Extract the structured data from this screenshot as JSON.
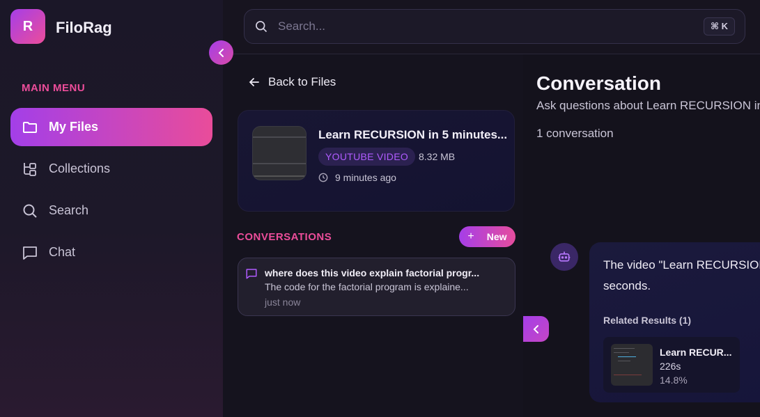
{
  "app": {
    "logo_letter": "R",
    "name": "FiloRag"
  },
  "sidebar": {
    "menu_title": "MAIN MENU",
    "items": [
      {
        "label": "My Files",
        "icon": "folder-icon",
        "active": true
      },
      {
        "label": "Collections",
        "icon": "collections-icon",
        "active": false
      },
      {
        "label": "Search",
        "icon": "search-icon",
        "active": false
      },
      {
        "label": "Chat",
        "icon": "chat-icon",
        "active": false
      }
    ]
  },
  "search": {
    "placeholder": "Search...",
    "shortcut": "⌘ K"
  },
  "file": {
    "back_label": "Back to Files",
    "title": "Learn RECURSION in 5 minutes...",
    "type_badge": "YOUTUBE VIDEO",
    "size": "8.32 MB",
    "uploaded": "9 minutes ago"
  },
  "conversations": {
    "title": "CONVERSATIONS",
    "new_label": "New",
    "items": [
      {
        "question": "where does this video explain factorial progr...",
        "answer": "The code for the factorial program is explaine...",
        "time": "just now"
      }
    ]
  },
  "conversation_panel": {
    "title": "Conversation",
    "subtitle": "Ask questions about Learn RECURSION in",
    "count": "1 conversation",
    "bot_message_line1": "The video \"Learn RECURSION",
    "bot_message_line2": "seconds.",
    "related_title": "Related Results (1)",
    "related": [
      {
        "title": "Learn RECUR...",
        "time": "226s",
        "score": "14.8%"
      }
    ]
  },
  "colors": {
    "accent_purple": "#a53ee8",
    "accent_pink": "#ec4d9a",
    "background": "#15131f"
  }
}
